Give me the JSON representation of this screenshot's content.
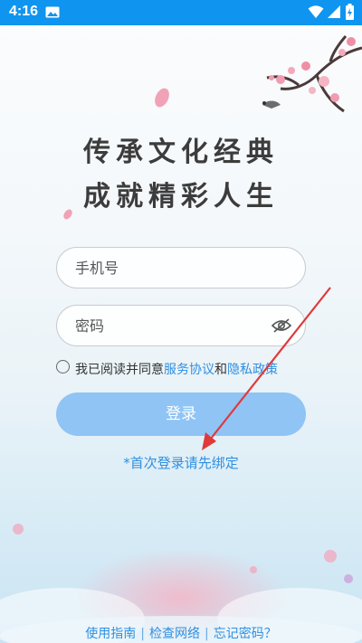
{
  "status_bar": {
    "time": "4:16",
    "icons": [
      "photo-icon",
      "wifi-icon",
      "signal-icon",
      "battery-icon"
    ],
    "background": "#0f95ef"
  },
  "title": {
    "line1": "传承文化经典",
    "line2": "成就精彩人生"
  },
  "form": {
    "phone_placeholder": "手机号",
    "password_placeholder": "密码"
  },
  "agreement": {
    "prefix": "我已阅读并同意",
    "service_link": "服务协议",
    "and": "和",
    "privacy_link": "隐私政策"
  },
  "login_button": "登录",
  "first_login_hint": "*首次登录请先绑定",
  "footer": {
    "guide": "使用指南",
    "separator": "|",
    "check_network": "检查网络",
    "forgot_password": "忘记密码？"
  },
  "colors": {
    "accent": "#2f8fe0",
    "button": "#8fc4f5",
    "arrow": "#e0393b"
  }
}
